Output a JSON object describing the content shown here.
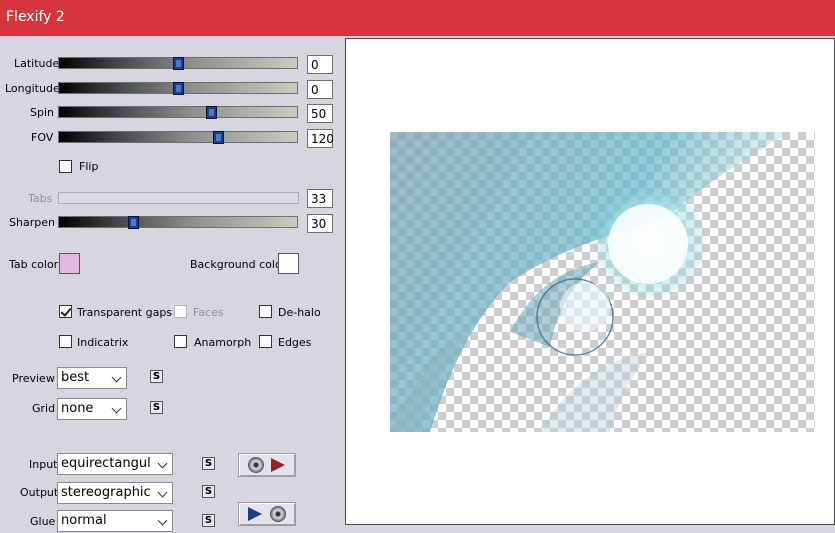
{
  "window": {
    "title": "Flexify 2"
  },
  "sliders": {
    "latitude": {
      "label": "Latitude",
      "value": "0",
      "fraction": 0.5
    },
    "longitude": {
      "label": "Longitude",
      "value": "0",
      "fraction": 0.5
    },
    "spin": {
      "label": "Spin",
      "value": "50",
      "fraction": 0.64
    },
    "fov": {
      "label": "FOV",
      "value": "120",
      "fraction": 0.67
    },
    "tabs": {
      "label": "Tabs",
      "value": "33",
      "disabled": true
    },
    "sharpen": {
      "label": "Sharpen",
      "value": "30",
      "fraction": 0.31
    }
  },
  "flip": {
    "label": "Flip",
    "checked": false
  },
  "colors": {
    "tab_color_label": "Tab color",
    "tab_color": "#e2b8e0",
    "background_color_label": "Background color",
    "background_color": "#ffffff"
  },
  "options": {
    "transparent_gaps": {
      "label": "Transparent gaps",
      "checked": true
    },
    "faces": {
      "label": "Faces",
      "checked": false,
      "disabled": true
    },
    "de_halo": {
      "label": "De-halo",
      "checked": false
    },
    "indicatrix": {
      "label": "Indicatrix",
      "checked": false
    },
    "anamorph": {
      "label": "Anamorph",
      "checked": false
    },
    "edges": {
      "label": "Edges",
      "checked": false
    }
  },
  "dropdowns": {
    "preview": {
      "label": "Preview",
      "value": "best"
    },
    "grid": {
      "label": "Grid",
      "value": "none"
    },
    "input": {
      "label": "Input",
      "value": "equirectangular"
    },
    "output": {
      "label": "Output",
      "value": "stereographic"
    },
    "glue": {
      "label": "Glue",
      "value": "normal"
    }
  },
  "lock_glyph": "S",
  "accent_colors": {
    "title_bar": "#d5353d",
    "slider_thumb": "#1e3f86",
    "play_red": "#9a1f2c",
    "play_blue": "#1a3e8c"
  }
}
